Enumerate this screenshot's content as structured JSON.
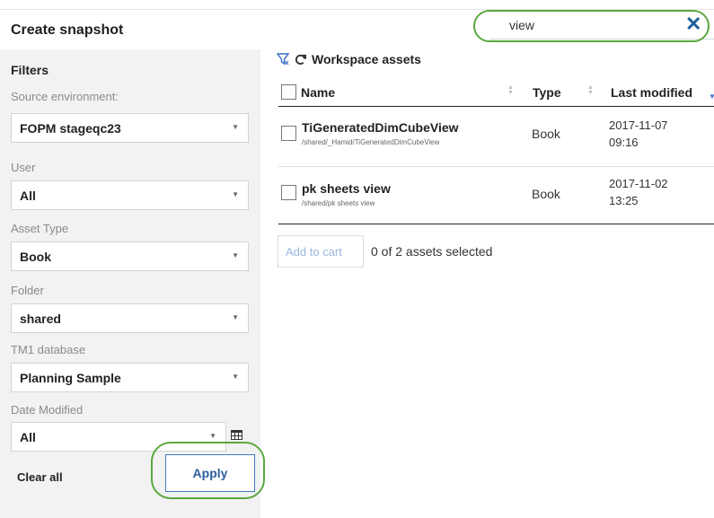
{
  "header": {
    "title": "Create snapshot",
    "search_value": "view",
    "clear_glyph": "✕"
  },
  "sidebar": {
    "heading": "Filters",
    "filters": [
      {
        "label": "Source environment:",
        "value": "FOPM stageqc23"
      },
      {
        "label": "User",
        "value": "All"
      },
      {
        "label": "Asset Type",
        "value": "Book"
      },
      {
        "label": "Folder",
        "value": "shared"
      },
      {
        "label": "TM1 database",
        "value": "Planning Sample"
      },
      {
        "label": "Date Modified",
        "value": "All"
      }
    ],
    "clear_all_label": "Clear all",
    "apply_label": "Apply"
  },
  "main": {
    "heading": "Workspace assets",
    "columns": {
      "name": "Name",
      "type": "Type",
      "last_modified": "Last modified"
    },
    "rows": [
      {
        "name": "TiGeneratedDimCubeView",
        "path": "/shared/_Hamid/TiGeneratedDimCubeView",
        "type": "Book",
        "date": "2017-11-07",
        "time": "09:16"
      },
      {
        "name": "pk sheets view",
        "path": "/shared/pk sheets view",
        "type": "Book",
        "date": "2017-11-02",
        "time": "13:25"
      }
    ],
    "add_to_cart_label": "Add to cart",
    "selection_count": "0 of 2 assets selected"
  },
  "colors": {
    "accent": "#4178be",
    "highlight_ring": "#5aa83f",
    "sidebar_bg": "#f2f2f2"
  },
  "icons": [
    "filter-icon",
    "refresh-icon",
    "close-icon",
    "caret-down-icon",
    "calendar-icon",
    "sort-icon"
  ]
}
